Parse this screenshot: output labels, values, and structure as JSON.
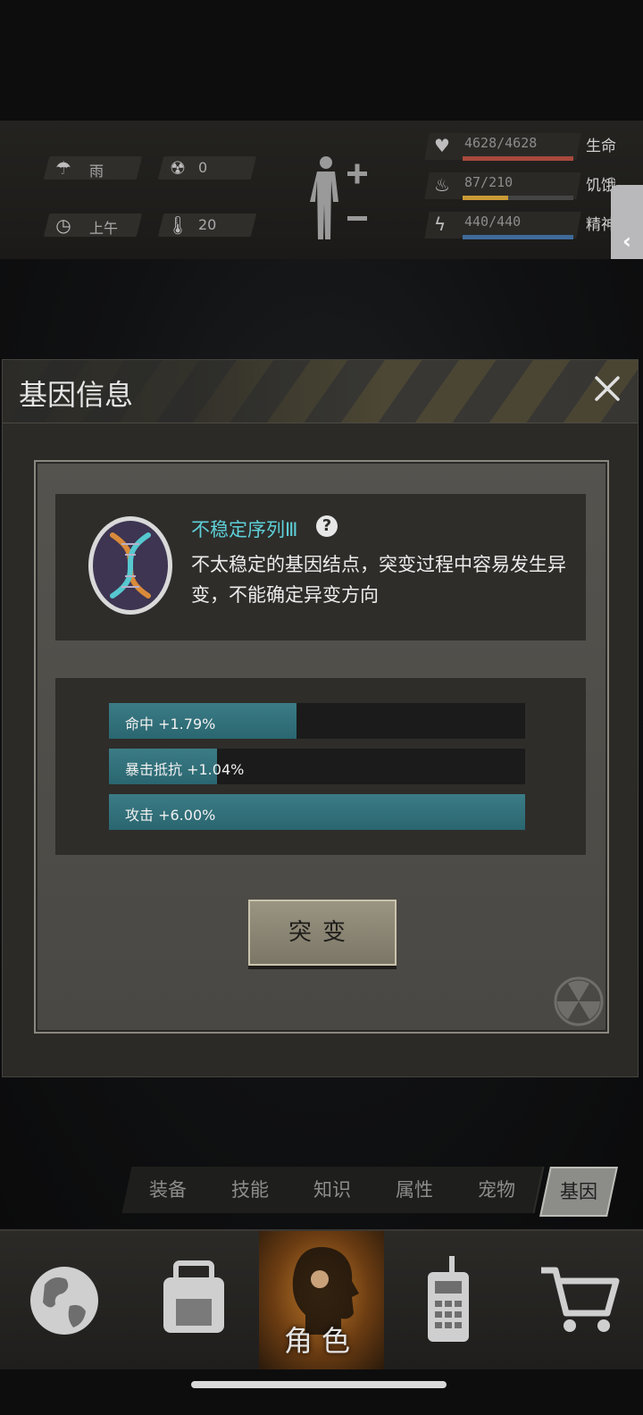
{
  "status": {
    "weather": "雨",
    "radiation": "0",
    "time_of_day": "上午",
    "temperature": "20"
  },
  "vitals": [
    {
      "icon": "heart-icon",
      "value": "4628/4628",
      "label": "生命",
      "fraction": 1.0,
      "color": "#a84a3c"
    },
    {
      "icon": "food-icon",
      "value": "87/210",
      "label": "饥饿",
      "fraction": 0.41,
      "color": "#c99a35"
    },
    {
      "icon": "energy-icon",
      "value": "440/440",
      "label": "精神",
      "fraction": 1.0,
      "color": "#3f6b9a"
    }
  ],
  "modal": {
    "title": "基因信息",
    "gene": {
      "name": "不稳定序列Ⅲ",
      "description": "不太稳定的基因结点，突变过程中容易发生异变，不能确定异变方向"
    },
    "attributes": [
      {
        "label": "命中 +1.79%",
        "fraction": 0.45
      },
      {
        "label": "暴击抵抗 +1.04%",
        "fraction": 0.26
      },
      {
        "label": "攻击 +6.00%",
        "fraction": 1.0
      }
    ],
    "mutate_label": "突变"
  },
  "subtabs": [
    "装备",
    "技能",
    "知识",
    "属性",
    "宠物",
    "基因"
  ],
  "subtab_active": "基因",
  "nav": {
    "active_label": "角色"
  },
  "colors": {
    "accent_teal": "#5ed0d8",
    "bar_teal": "#2f6f79"
  }
}
